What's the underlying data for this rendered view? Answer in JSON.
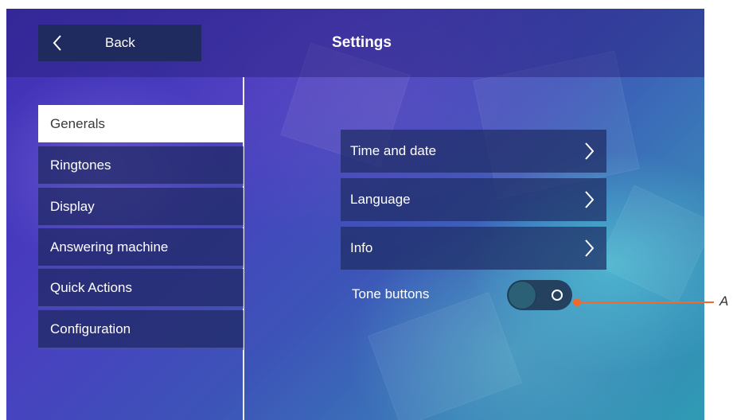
{
  "header": {
    "back_label": "Back",
    "title": "Settings"
  },
  "sidebar": {
    "items": [
      {
        "label": "Generals",
        "active": true
      },
      {
        "label": "Ringtones",
        "active": false
      },
      {
        "label": "Display",
        "active": false
      },
      {
        "label": "Answering machine",
        "active": false
      },
      {
        "label": "Quick Actions",
        "active": false
      },
      {
        "label": "Configuration",
        "active": false
      }
    ]
  },
  "main": {
    "options": [
      {
        "label": "Time and date"
      },
      {
        "label": "Language"
      },
      {
        "label": "Info"
      }
    ],
    "tone_buttons": {
      "label": "Tone buttons",
      "state": "off"
    }
  },
  "annotation": {
    "label": "A"
  },
  "colors": {
    "callout": "#f26a2a",
    "active_menu_bg": "#ffffff",
    "menu_bg": "#1e285f"
  },
  "icons": {
    "back": "chevron-left-icon",
    "row": "chevron-right-icon"
  }
}
